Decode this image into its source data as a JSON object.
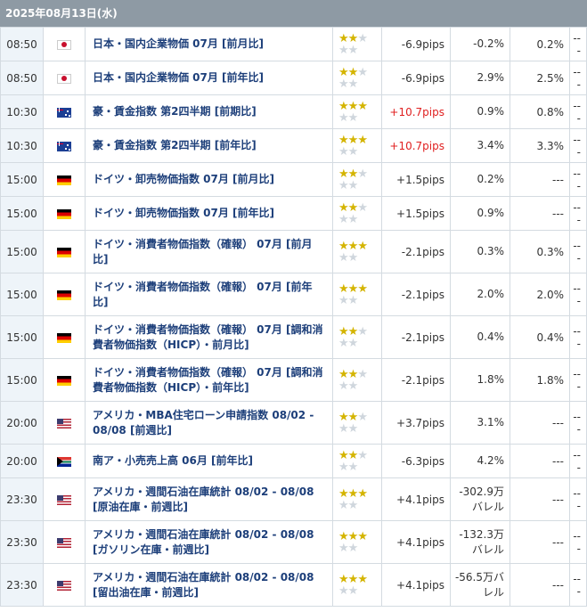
{
  "date_header": "2025年08月13日(水)",
  "rows": [
    {
      "time": "08:50",
      "country": "jp",
      "name": "日本・国内企業物価 07月 [前月比]",
      "stars": 2,
      "pips": "-6.9pips",
      "pips_red": false,
      "prev": "-0.2%",
      "forecast": "0.2%",
      "result": "---"
    },
    {
      "time": "08:50",
      "country": "jp",
      "name": "日本・国内企業物価 07月 [前年比]",
      "stars": 2,
      "pips": "-6.9pips",
      "pips_red": false,
      "prev": "2.9%",
      "forecast": "2.5%",
      "result": "---"
    },
    {
      "time": "10:30",
      "country": "au",
      "name": "豪・賃金指数 第2四半期 [前期比]",
      "stars": 3,
      "pips": "+10.7pips",
      "pips_red": true,
      "prev": "0.9%",
      "forecast": "0.8%",
      "result": "---"
    },
    {
      "time": "10:30",
      "country": "au",
      "name": "豪・賃金指数 第2四半期 [前年比]",
      "stars": 3,
      "pips": "+10.7pips",
      "pips_red": true,
      "prev": "3.4%",
      "forecast": "3.3%",
      "result": "---"
    },
    {
      "time": "15:00",
      "country": "de",
      "name": "ドイツ・卸売物価指数 07月 [前月比]",
      "stars": 2,
      "pips": "+1.5pips",
      "pips_red": false,
      "prev": "0.2%",
      "forecast": "---",
      "result": "---"
    },
    {
      "time": "15:00",
      "country": "de",
      "name": "ドイツ・卸売物価指数 07月 [前年比]",
      "stars": 2,
      "pips": "+1.5pips",
      "pips_red": false,
      "prev": "0.9%",
      "forecast": "---",
      "result": "---"
    },
    {
      "time": "15:00",
      "country": "de",
      "name": "ドイツ・消費者物価指数（確報） 07月 [前月比]",
      "stars": 3,
      "pips": "-2.1pips",
      "pips_red": false,
      "prev": "0.3%",
      "forecast": "0.3%",
      "result": "---"
    },
    {
      "time": "15:00",
      "country": "de",
      "name": "ドイツ・消費者物価指数（確報） 07月 [前年比]",
      "stars": 3,
      "pips": "-2.1pips",
      "pips_red": false,
      "prev": "2.0%",
      "forecast": "2.0%",
      "result": "---"
    },
    {
      "time": "15:00",
      "country": "de",
      "name": "ドイツ・消費者物価指数（確報） 07月 [調和消費者物価指数（HICP）・前月比]",
      "stars": 2,
      "pips": "-2.1pips",
      "pips_red": false,
      "prev": "0.4%",
      "forecast": "0.4%",
      "result": "---"
    },
    {
      "time": "15:00",
      "country": "de",
      "name": "ドイツ・消費者物価指数（確報） 07月 [調和消費者物価指数（HICP）・前年比]",
      "stars": 2,
      "pips": "-2.1pips",
      "pips_red": false,
      "prev": "1.8%",
      "forecast": "1.8%",
      "result": "---"
    },
    {
      "time": "20:00",
      "country": "us",
      "name": "アメリカ・MBA住宅ローン申請指数 08/02 - 08/08 [前週比]",
      "stars": 2,
      "pips": "+3.7pips",
      "pips_red": false,
      "prev": "3.1%",
      "forecast": "---",
      "result": "---"
    },
    {
      "time": "20:00",
      "country": "za",
      "name": "南ア・小売売上高 06月 [前年比]",
      "stars": 2,
      "pips": "-6.3pips",
      "pips_red": false,
      "prev": "4.2%",
      "forecast": "---",
      "result": "---"
    },
    {
      "time": "23:30",
      "country": "us",
      "name": "アメリカ・週間石油在庫統計 08/02 - 08/08 [原油在庫・前週比]",
      "stars": 3,
      "pips": "+4.1pips",
      "pips_red": false,
      "prev": "-302.9万バレル",
      "forecast": "---",
      "result": "---"
    },
    {
      "time": "23:30",
      "country": "us",
      "name": "アメリカ・週間石油在庫統計 08/02 - 08/08 [ガソリン在庫・前週比]",
      "stars": 3,
      "pips": "+4.1pips",
      "pips_red": false,
      "prev": "-132.3万バレル",
      "forecast": "---",
      "result": "---"
    },
    {
      "time": "23:30",
      "country": "us",
      "name": "アメリカ・週間石油在庫統計 08/02 - 08/08 [留出油在庫・前週比]",
      "stars": 3,
      "pips": "+4.1pips",
      "pips_red": false,
      "prev": "-56.5万バレル",
      "forecast": "---",
      "result": "---"
    }
  ]
}
